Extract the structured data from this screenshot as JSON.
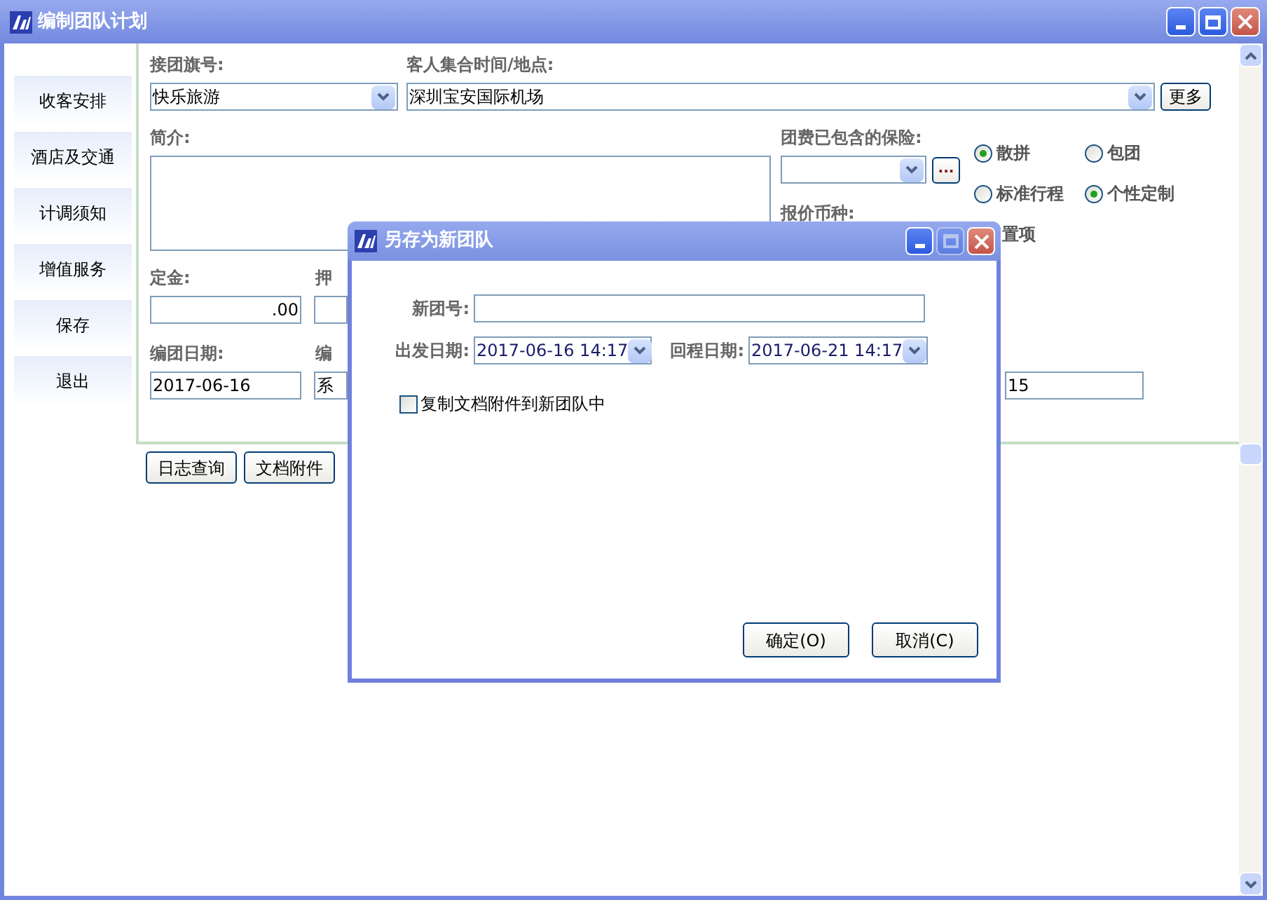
{
  "window": {
    "title": "编制团队计划"
  },
  "sidebar": {
    "items": [
      {
        "label": "收客安排"
      },
      {
        "label": "酒店及交通"
      },
      {
        "label": "计调须知"
      },
      {
        "label": "增值服务"
      },
      {
        "label": "保存"
      },
      {
        "label": "退出"
      }
    ]
  },
  "form": {
    "tour_flag": {
      "label": "接团旗号:",
      "value": "快乐旅游"
    },
    "meeting": {
      "label": "客人集合时间/地点:",
      "value": "深圳宝安国际机场",
      "more_button": "更多"
    },
    "intro": {
      "label": "简介:"
    },
    "insurance": {
      "label": "团费已包含的保险:",
      "browse_button": "..."
    },
    "currency": {
      "label": "报价币种:"
    },
    "tour_type": [
      {
        "label": "散拼",
        "selected": true
      },
      {
        "label": "包团",
        "selected": false
      }
    ],
    "itinerary_type": [
      {
        "label": "标准行程",
        "selected": false
      },
      {
        "label": "个性定制",
        "selected": true
      }
    ],
    "pinned": {
      "label": "置项"
    },
    "deposit": {
      "label": "定金:",
      "value": ".00"
    },
    "column_2_label": "押",
    "created_date": {
      "label": "编团日期:",
      "value": "2017-06-16"
    },
    "column_2_label_2": "编",
    "column_2_value": "系",
    "column_3_value": "15"
  },
  "buttons": [
    "日志查询",
    "文档附件"
  ],
  "dialog": {
    "title": "另存为新团队",
    "maximize_disabled": true,
    "new_group": {
      "label": "新团号:"
    },
    "departure": {
      "label": "出发日期:",
      "value": "2017-06-16 14:17"
    },
    "return": {
      "label": "回程日期:",
      "value": "2017-06-21 14:17"
    },
    "copy_attachments": {
      "label": "复制文档附件到新团队中",
      "checked": false
    },
    "buttons": [
      "确定(O)",
      "取消(C)"
    ]
  }
}
